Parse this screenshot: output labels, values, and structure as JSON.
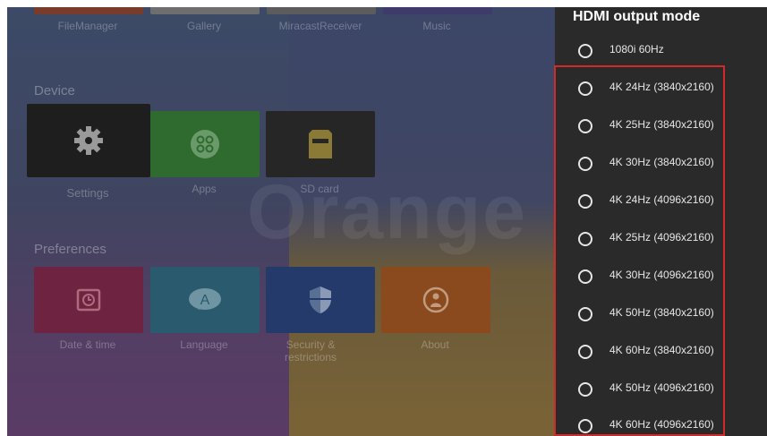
{
  "launcher": {
    "top_apps": [
      "FileManager",
      "Gallery",
      "MiracastReceiver",
      "Music"
    ],
    "sections": {
      "device": "Device",
      "preferences": "Preferences"
    },
    "device_apps": [
      "Settings",
      "Apps",
      "SD card"
    ],
    "preference_apps": [
      "Date & time",
      "Language",
      "Security & restrictions",
      "About"
    ],
    "watermark": "Orange p",
    "icons": [
      "gear-icon",
      "apps-grid-icon",
      "sd-card-icon",
      "clock-icon",
      "language-icon",
      "shield-icon",
      "info-icon"
    ]
  },
  "panel": {
    "title": "HDMI output mode",
    "options": [
      "1080i 60Hz",
      "4K 24Hz (3840x2160)",
      "4K 25Hz (3840x2160)",
      "4K 30Hz (3840x2160)",
      "4K 24Hz (4096x2160)",
      "4K 25Hz (4096x2160)",
      "4K 30Hz (4096x2160)",
      "4K 50Hz (3840x2160)",
      "4K 60Hz (3840x2160)",
      "4K 50Hz (4096x2160)",
      "4K 60Hz (4096x2160)"
    ]
  },
  "colors": {
    "highlight_border": "#d12a2a",
    "panel_background": "#2a2a2a"
  }
}
